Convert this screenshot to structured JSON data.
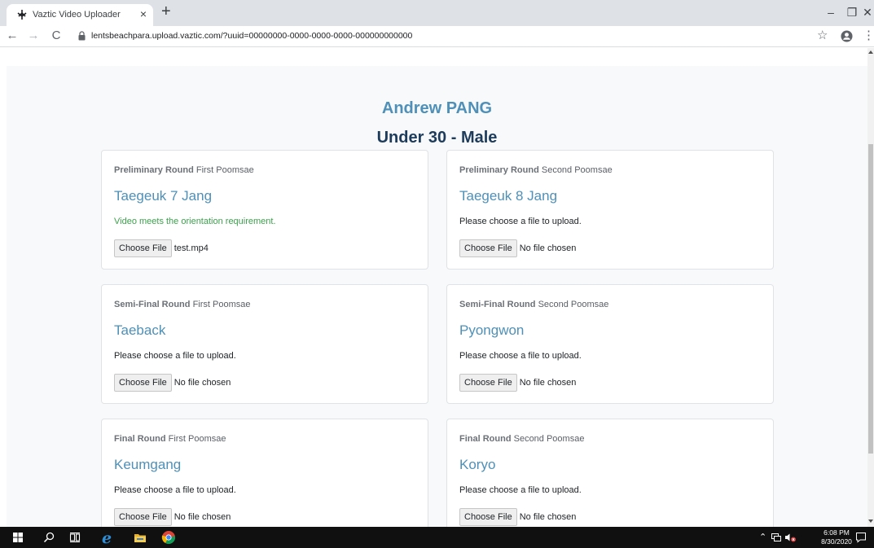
{
  "browser": {
    "tab_title": "Vaztic Video Uploader",
    "tab_close": "×",
    "new_tab": "+",
    "url": "lentsbeachpara.upload.vaztic.com/?uuid=00000000-0000-0000-0000-000000000000",
    "window_controls": {
      "minimize": "–",
      "restore": "❐",
      "close": "✕"
    },
    "nav": {
      "back": "←",
      "forward": "→",
      "reload": "C"
    },
    "icons": [
      "vaztic-logo-icon",
      "lock-icon",
      "star-icon",
      "profile-icon",
      "menu-icon"
    ]
  },
  "page": {
    "athlete_name": "Andrew PANG",
    "division": "Under 30 - Male",
    "cards": [
      {
        "round": "Preliminary Round",
        "slot": "First Poomsae",
        "poomsae": "Taegeuk 7 Jang",
        "status": "Video meets the orientation requirement.",
        "status_ok": true,
        "button": "Choose File",
        "file": "test.mp4"
      },
      {
        "round": "Preliminary Round",
        "slot": "Second Poomsae",
        "poomsae": "Taegeuk 8 Jang",
        "status": "Please choose a file to upload.",
        "status_ok": false,
        "button": "Choose File",
        "file": "No file chosen"
      },
      {
        "round": "Semi-Final Round",
        "slot": "First Poomsae",
        "poomsae": "Taeback",
        "status": "Please choose a file to upload.",
        "status_ok": false,
        "button": "Choose File",
        "file": "No file chosen"
      },
      {
        "round": "Semi-Final Round",
        "slot": "Second Poomsae",
        "poomsae": "Pyongwon",
        "status": "Please choose a file to upload.",
        "status_ok": false,
        "button": "Choose File",
        "file": "No file chosen"
      },
      {
        "round": "Final Round",
        "slot": "First Poomsae",
        "poomsae": "Keumgang",
        "status": "Please choose a file to upload.",
        "status_ok": false,
        "button": "Choose File",
        "file": "No file chosen"
      },
      {
        "round": "Final Round",
        "slot": "Second Poomsae",
        "poomsae": "Koryo",
        "status": "Please choose a file to upload.",
        "status_ok": false,
        "button": "Choose File",
        "file": "No file chosen"
      }
    ]
  },
  "taskbar": {
    "time": "6:08 PM",
    "date": "8/30/2020",
    "icons": [
      "windows-start-icon",
      "search-icon",
      "task-view-icon",
      "edge-icon",
      "file-explorer-icon",
      "chrome-icon",
      "tray-chevron-icon",
      "network-icon",
      "volume-muted-icon",
      "notification-icon"
    ]
  },
  "colors": {
    "accent": "#4e90b8",
    "division": "#1d3c5c",
    "success": "#3aa34b",
    "page_bg": "#f8f9fa"
  }
}
